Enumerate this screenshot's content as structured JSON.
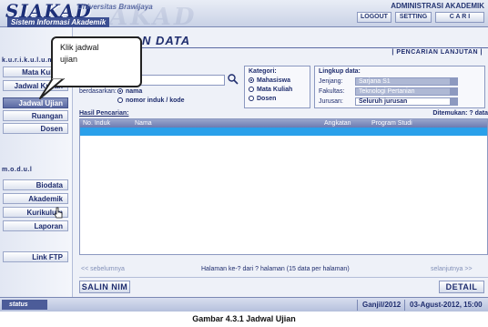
{
  "header": {
    "logo": "SIAKAD",
    "logo_subtitle": "Sistem Informasi Akademik",
    "university": "Universitas Brawijaya",
    "watermark": "AKAD",
    "app_title": "ADMINISTRASI AKADEMIK",
    "logout_label": "LOGOUT",
    "setting_label": "SETTING",
    "cari_label": "C A R I"
  },
  "callout": {
    "line1": "Klik jadwal",
    "line2": "ujian"
  },
  "sidebar": {
    "section_kurikulum": "k.u.r.i.k.u.l.u.m",
    "kurikulum_items": [
      {
        "label": "Mata Kuliah",
        "active": false
      },
      {
        "label": "Jadwal Kuliah",
        "active": false
      },
      {
        "label": "Jadwal Ujian",
        "active": true
      },
      {
        "label": "Ruangan",
        "active": false
      },
      {
        "label": "Dosen",
        "active": false
      }
    ],
    "section_modul": "m.o.d.u.l",
    "modul_items": [
      {
        "label": "Biodata"
      },
      {
        "label": "Akademik"
      },
      {
        "label": "Kurikulum"
      },
      {
        "label": "Laporan"
      }
    ],
    "link_ftp": "Link FTP"
  },
  "main": {
    "title": "IAN DATA",
    "advanced_search": "| PENCARIAN LANJUTAN |",
    "search_input_value": "",
    "berdasarkan_label": "berdasarkan:",
    "search_by_options": [
      {
        "label": "nama",
        "selected": true
      },
      {
        "label": "nomor induk / kode",
        "selected": false
      }
    ],
    "kategori": {
      "title": "Kategori:",
      "options": [
        {
          "label": "Mahasiswa",
          "selected": true
        },
        {
          "label": "Mata Kuliah",
          "selected": false
        },
        {
          "label": "Dosen",
          "selected": false
        }
      ]
    },
    "lingkup": {
      "title": "Lingkup data:",
      "jenjang_label": "Jenjang:",
      "jenjang_value": "Sarjana S1",
      "fakultas_label": "Fakultas:",
      "fakultas_value": "Teknologi Pertanian",
      "jurusan_label": "Jurusan:",
      "jurusan_value": "Seluruh jurusan"
    },
    "results_label": "Hasil Pencarian:",
    "results_found": "Ditemukan: ? data",
    "columns": [
      "No. Induk",
      "Nama",
      "Angkatan",
      "Program Studi"
    ],
    "pager": {
      "prev": "<< sebelumnya",
      "info": "Halaman ke-? dari ? halaman (15 data per halaman)",
      "next": "selanjutnya >>"
    },
    "salin_nim": "SALIN NIM",
    "detail": "DETAIL"
  },
  "status": {
    "label": "status",
    "term": "Ganjil/2012",
    "date": "03-Agust-2012, 15:00"
  },
  "caption": "Gambar 4.3.1 Jadwal Ujian",
  "colors": {
    "primary": "#1f2d6e",
    "highlight_row": "#2aa0ea",
    "active_nav": "#5b6aa3"
  }
}
